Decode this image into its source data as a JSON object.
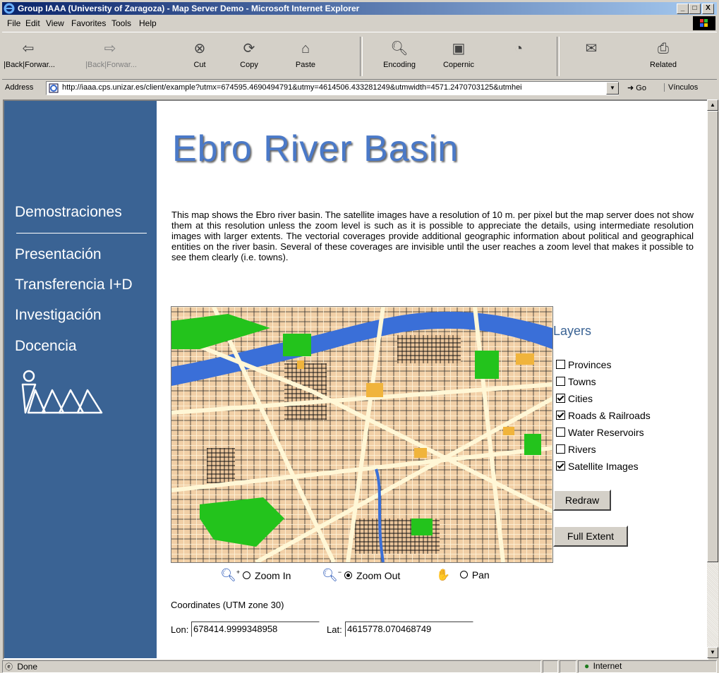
{
  "window": {
    "title": "Group IAAA (University of Zaragoza) - Map Server Demo - Microsoft Internet Explorer",
    "min": "_",
    "max": "□",
    "close": "X"
  },
  "menu": [
    "File",
    "Edit",
    "View",
    "Favorites",
    "Tools",
    "Help"
  ],
  "toolbar": {
    "back": "|Back|Forwar...",
    "forward": "|Back|Forwar...",
    "cut": "Cut",
    "copy": "Copy",
    "paste": "Paste",
    "encoding": "Encoding",
    "copernic": "Copernic",
    "related": "Related"
  },
  "address": {
    "label": "Address",
    "url": "http://iaaa.cps.unizar.es/client/example?utmx=674595.4690494791&utmy=4614506.433281249&utmwidth=4571.2470703125&utmhei",
    "go": "Go",
    "links": "Vínculos"
  },
  "sidebar": {
    "items": [
      "Demostraciones",
      "Presentación",
      "Transferencia I+D",
      "Investigación",
      "Docencia"
    ]
  },
  "page": {
    "title": "Ebro River Basin",
    "description": "This map shows the Ebro river basin. The satellite images have a resolution of 10 m. per pixel but the map server does not show them at this resolution unless the zoom level is such as it is possible to appreciate the details, using intermediate resolution images with larger extents. The vectorial coverages provide additional geographic information about political and geographical entities on the river basin. Several of these coverages are invisible until the user reaches a zoom level that makes it possible to see them clearly (i.e. towns)."
  },
  "layers": {
    "title": "Layers",
    "items": [
      {
        "label": "Provinces",
        "checked": false
      },
      {
        "label": "Towns",
        "checked": false
      },
      {
        "label": "Cities",
        "checked": true
      },
      {
        "label": "Roads & Railroads",
        "checked": true
      },
      {
        "label": "Water Reservoirs",
        "checked": false
      },
      {
        "label": "Rivers",
        "checked": false
      },
      {
        "label": "Satellite Images",
        "checked": true
      }
    ],
    "redraw": "Redraw",
    "full_extent": "Full Extent"
  },
  "tools": {
    "zoom_in": "Zoom In",
    "zoom_out": "Zoom Out",
    "pan": "Pan",
    "selected": "zoom_out"
  },
  "coords": {
    "label": "Coordinates (UTM zone 30)",
    "lon_label": "Lon:",
    "lon": "678414.9999348958",
    "lat_label": "Lat:",
    "lat": "4615778.070468749"
  },
  "status": {
    "text": "Done",
    "zone": "Internet"
  },
  "colors": {
    "sidebar": "#3a6394",
    "title": "#4a79c8"
  }
}
